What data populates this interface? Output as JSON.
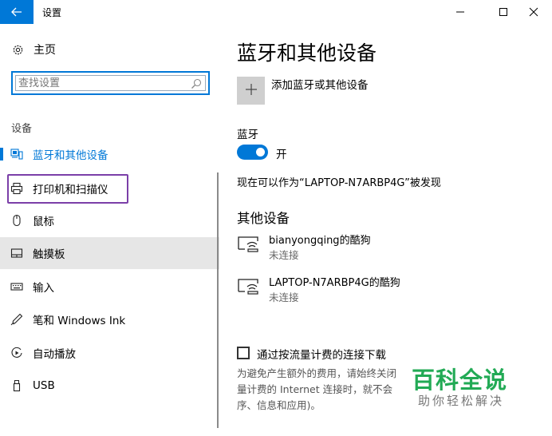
{
  "window": {
    "title": "设置",
    "controls": {
      "minimize_icon": "minimize-icon",
      "maximize_icon": "maximize-icon",
      "close_icon": "close-icon"
    }
  },
  "sidebar": {
    "home_label": "主页",
    "search": {
      "placeholder": "查找设置",
      "value": ""
    },
    "section_label": "设备",
    "items": [
      {
        "label": "蓝牙和其他设备",
        "icon": "bluetooth-devices-icon",
        "state": "active"
      },
      {
        "label": "打印机和扫描仪",
        "icon": "printer-icon",
        "state": "highlighted"
      },
      {
        "label": "鼠标",
        "icon": "mouse-icon",
        "state": "normal"
      },
      {
        "label": "触摸板",
        "icon": "touchpad-icon",
        "state": "selected"
      },
      {
        "label": "输入",
        "icon": "keyboard-icon",
        "state": "normal"
      },
      {
        "label": "笔和 Windows Ink",
        "icon": "pen-icon",
        "state": "normal"
      },
      {
        "label": "自动播放",
        "icon": "autoplay-icon",
        "state": "normal"
      },
      {
        "label": "USB",
        "icon": "usb-icon",
        "state": "normal"
      }
    ]
  },
  "main": {
    "title": "蓝牙和其他设备",
    "add_device_label": "添加蓝牙或其他设备",
    "bluetooth": {
      "heading": "蓝牙",
      "toggle_on": true,
      "toggle_label": "开",
      "discoverable_text": "现在可以作为“LAPTOP-N7ARBP4G”被发现"
    },
    "other_devices": {
      "heading": "其他设备",
      "devices": [
        {
          "name": "bianyongqing的酷狗",
          "status": "未连接",
          "icon": "wireless-display-icon"
        },
        {
          "name": "LAPTOP-N7ARBP4G的酷狗",
          "status": "未连接",
          "icon": "wireless-display-icon"
        }
      ]
    },
    "metered": {
      "checked": false,
      "label": "通过按流量计费的连接下载",
      "description": "为避免产生额外的费用，请始终关闭量计费的 Internet 连接时，就不会序、信息和应用)。"
    }
  },
  "watermark": {
    "main": "百科全说",
    "sub": "助你轻松解决"
  },
  "colors": {
    "accent": "#0078d7",
    "highlight_border": "#7b3fa8",
    "selected_bg": "#e6e6e6",
    "watermark_green": "#22aa55"
  }
}
